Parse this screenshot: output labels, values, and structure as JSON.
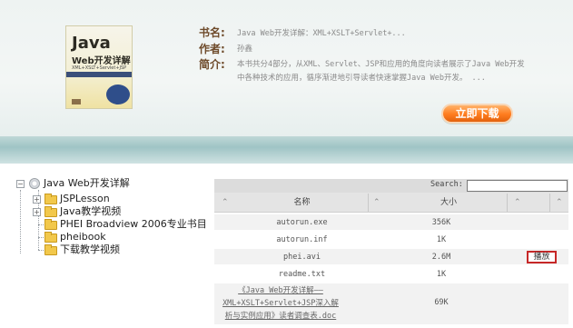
{
  "book": {
    "title_label": "书名:",
    "title_value": "Java Web开发详解：XML+XSLT+Servlet+...",
    "author_label": "作者:",
    "author_value": "孙鑫",
    "summary_label": "简介:",
    "summary_value": "本书共分4部分，从XML、Servlet、JSP和应用的角度向读者展示了Java Web开发中各种技术的应用，循序渐进地引导读者快速掌握Java Web开发。 ...",
    "download_label": "立即下载"
  },
  "cover": {
    "title_line1": "Java",
    "title_line2": "Web开发详解",
    "subtitle": "XML+XSLT+Servlet+JSP"
  },
  "tree": {
    "root": "Java Web开发详解",
    "items": [
      {
        "label": "JSPLesson",
        "expandable": true
      },
      {
        "label": "Java教学视频",
        "expandable": true
      },
      {
        "label": "PHEI Broadview 2006专业书目",
        "expandable": false
      },
      {
        "label": "pheibook",
        "expandable": false
      },
      {
        "label": "下载教学视频",
        "expandable": false
      }
    ]
  },
  "table": {
    "search_label": "Search:",
    "columns": [
      "名称",
      "大小"
    ],
    "sort_glyph": "⌃",
    "rows": [
      {
        "name": "autorun.exe",
        "size": "356K",
        "action": ""
      },
      {
        "name": "autorun.inf",
        "size": "1K",
        "action": ""
      },
      {
        "name": "phei.avi",
        "size": "2.6M",
        "action": "播放"
      },
      {
        "name": "readme.txt",
        "size": "1K",
        "action": ""
      },
      {
        "name": "《Java Web开发详解——XML+XSLT+Servlet+JSP深入解析与实例应用》读者调查表.doc",
        "size": "69K",
        "action": ""
      }
    ]
  }
}
